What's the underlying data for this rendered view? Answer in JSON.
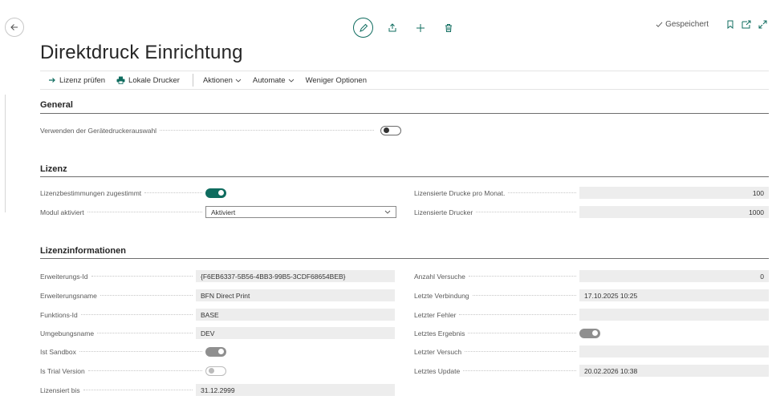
{
  "page": {
    "title": "Direktdruck Einrichtung"
  },
  "header": {
    "saved_label": "Gespeichert"
  },
  "actions": {
    "license_check": "Lizenz prüfen",
    "local_printers": "Lokale Drucker",
    "actions_menu": "Aktionen",
    "automate_menu": "Automate",
    "fewer_options": "Weniger Optionen"
  },
  "general": {
    "title": "General",
    "device_printer_selection": {
      "label": "Verwenden der Gerätedruckerauswahl",
      "on": false
    }
  },
  "license": {
    "title": "Lizenz",
    "terms_accepted": {
      "label": "Lizenzbestimmungen zugestimmt",
      "on": true
    },
    "module_activated": {
      "label": "Modul aktiviert",
      "value": "Aktiviert"
    },
    "prints_per_month": {
      "label": "Lizensierte Drucke pro Monat.",
      "value": "100"
    },
    "licensed_printers": {
      "label": "Lizensierte Drucker",
      "value": "1000"
    }
  },
  "license_info": {
    "title": "Lizenzinformationen",
    "extension_id": {
      "label": "Erweiterungs-Id",
      "value": "{F6EB6337-5B56-4BB3-99B5-3CDF68654BEB}"
    },
    "extension_name": {
      "label": "Erweiterungsname",
      "value": "BFN Direct Print"
    },
    "function_id": {
      "label": "Funktions-Id",
      "value": "BASE"
    },
    "environment_name": {
      "label": "Umgebungsname",
      "value": "DEV"
    },
    "is_sandbox": {
      "label": "Ist Sandbox",
      "on": true
    },
    "is_trial": {
      "label": "Is Trial Version",
      "on": false
    },
    "licensed_until": {
      "label": "Lizensiert bis",
      "value": "31.12.2999"
    },
    "attempt_count": {
      "label": "Anzahl Versuche",
      "value": "0"
    },
    "last_connection": {
      "label": "Letzte Verbindung",
      "value": "17.10.2025 10:25"
    },
    "last_error": {
      "label": "Letzter Fehler",
      "value": ""
    },
    "last_result": {
      "label": "Letztes Ergebnis",
      "on": true
    },
    "last_attempt": {
      "label": "Letzter Versuch",
      "value": ""
    },
    "last_update": {
      "label": "Letztes Update",
      "value": "20.02.2026 10:38"
    }
  }
}
